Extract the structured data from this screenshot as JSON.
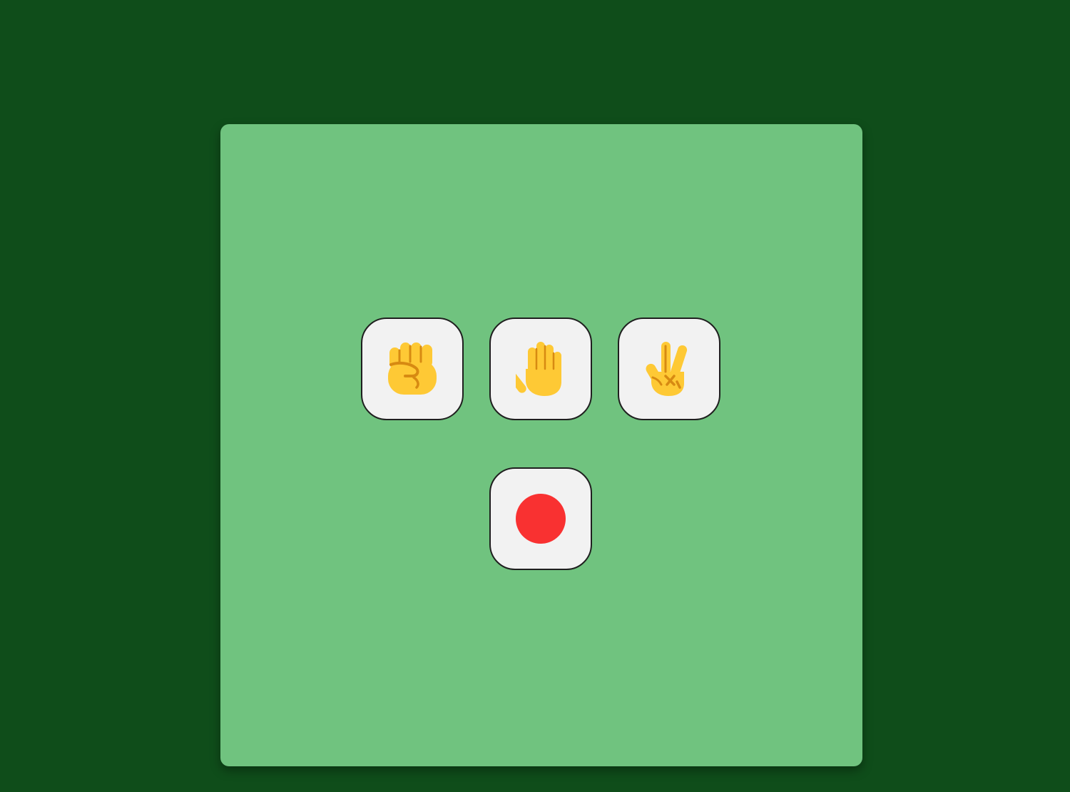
{
  "colors": {
    "background": "#0f4d1a",
    "board": "#70c37f",
    "tile": "#f2f2f2",
    "tile_border": "#1f1f1f",
    "hand_fill": "#fec935",
    "hand_shade": "#d78a12",
    "record": "#f93131"
  },
  "choices": [
    {
      "id": "rock",
      "icon": "raised-fist-icon",
      "glyph": "✊"
    },
    {
      "id": "paper",
      "icon": "raised-hand-icon",
      "glyph": "✋"
    },
    {
      "id": "scissors",
      "icon": "victory-hand-icon",
      "glyph": "✌️"
    }
  ],
  "record_button": {
    "icon": "record-dot-icon"
  }
}
